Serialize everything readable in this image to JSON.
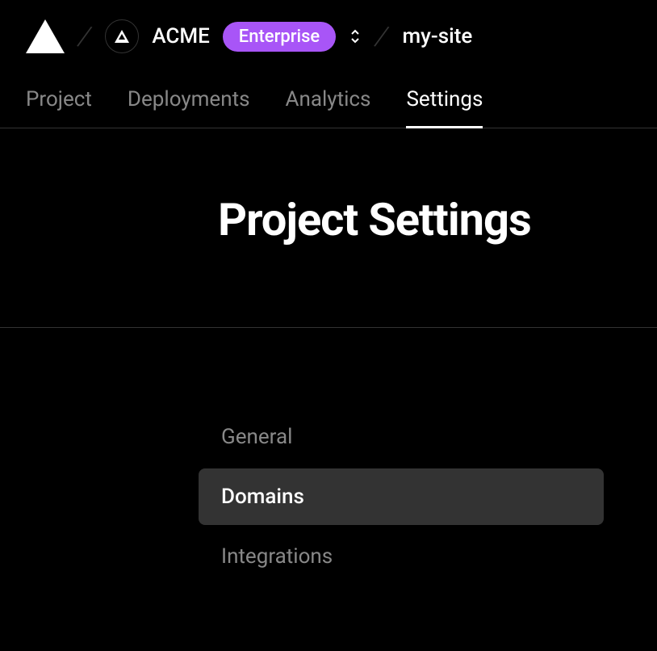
{
  "header": {
    "team_name": "ACME",
    "badge_label": "Enterprise",
    "project_name": "my-site"
  },
  "tabs": {
    "items": [
      {
        "label": "Project",
        "active": false
      },
      {
        "label": "Deployments",
        "active": false
      },
      {
        "label": "Analytics",
        "active": false
      },
      {
        "label": "Settings",
        "active": true
      }
    ]
  },
  "page": {
    "title": "Project Settings"
  },
  "sidebar": {
    "items": [
      {
        "label": "General",
        "active": false
      },
      {
        "label": "Domains",
        "active": true
      },
      {
        "label": "Integrations",
        "active": false
      }
    ]
  }
}
